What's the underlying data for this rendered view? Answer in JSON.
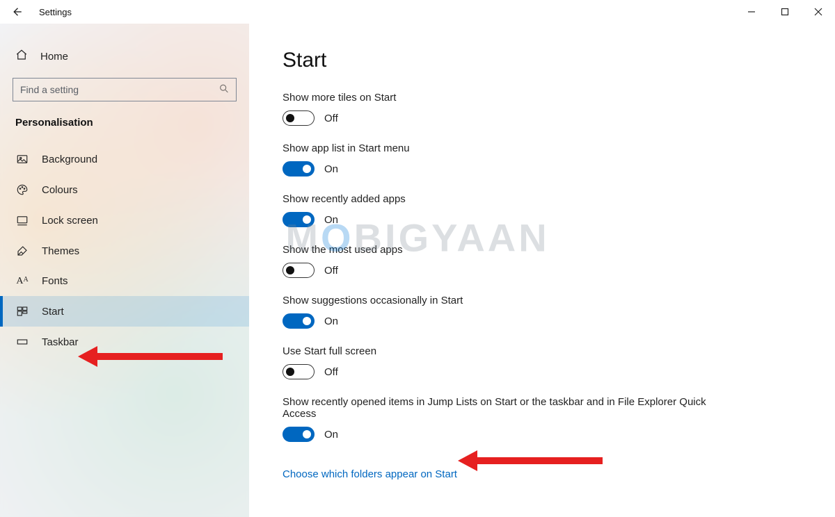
{
  "window": {
    "title": "Settings"
  },
  "sidebar": {
    "home": "Home",
    "search_placeholder": "Find a setting",
    "section": "Personalisation",
    "items": [
      {
        "label": "Background"
      },
      {
        "label": "Colours"
      },
      {
        "label": "Lock screen"
      },
      {
        "label": "Themes"
      },
      {
        "label": "Fonts"
      },
      {
        "label": "Start"
      },
      {
        "label": "Taskbar"
      }
    ]
  },
  "page": {
    "title": "Start",
    "toggle_on": "On",
    "toggle_off": "Off",
    "settings": [
      {
        "label": "Show more tiles on Start",
        "state": "off"
      },
      {
        "label": "Show app list in Start menu",
        "state": "on"
      },
      {
        "label": "Show recently added apps",
        "state": "on"
      },
      {
        "label": "Show the most used apps",
        "state": "off"
      },
      {
        "label": "Show suggestions occasionally in Start",
        "state": "on"
      },
      {
        "label": "Use Start full screen",
        "state": "off"
      },
      {
        "label": "Show recently opened items in Jump Lists on Start or the taskbar and in File Explorer Quick Access",
        "state": "on"
      }
    ],
    "link": "Choose which folders appear on Start"
  },
  "watermark": {
    "pre": "M",
    "o": "O",
    "post": "BIGYAAN"
  }
}
